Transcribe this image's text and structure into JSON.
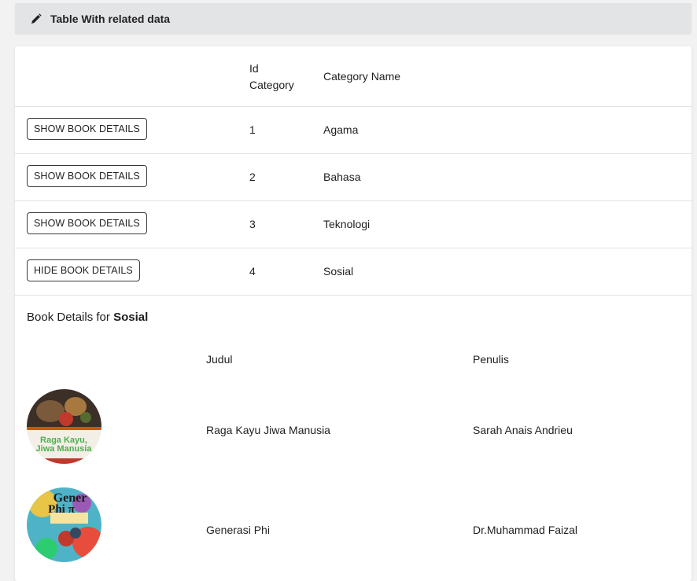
{
  "header": {
    "title": "Table With related data",
    "icon": "pencil-icon"
  },
  "table": {
    "columns": {
      "id": "Id Category",
      "name": "Category Name"
    },
    "rows": [
      {
        "button": "SHOW BOOK DETAILS",
        "id": "1",
        "name": "Agama"
      },
      {
        "button": "SHOW BOOK DETAILS",
        "id": "2",
        "name": "Bahasa"
      },
      {
        "button": "SHOW BOOK DETAILS",
        "id": "3",
        "name": "Teknologi"
      },
      {
        "button": "HIDE BOOK DETAILS",
        "id": "4",
        "name": "Sosial"
      }
    ]
  },
  "details": {
    "prefix": "Book Details for",
    "category": "Sosial",
    "columns": {
      "judul": "Judul",
      "penulis": "Penulis"
    },
    "books": [
      {
        "judul": "Raga Kayu Jiwa Manusia",
        "penulis": "Sarah Anais Andrieu",
        "cover_text": "Raga Kayu, Jiwa Manusia"
      },
      {
        "judul": "Generasi Phi",
        "penulis": "Dr.Muhammad Faizal",
        "cover_text": "Generasi Phi π"
      }
    ]
  }
}
